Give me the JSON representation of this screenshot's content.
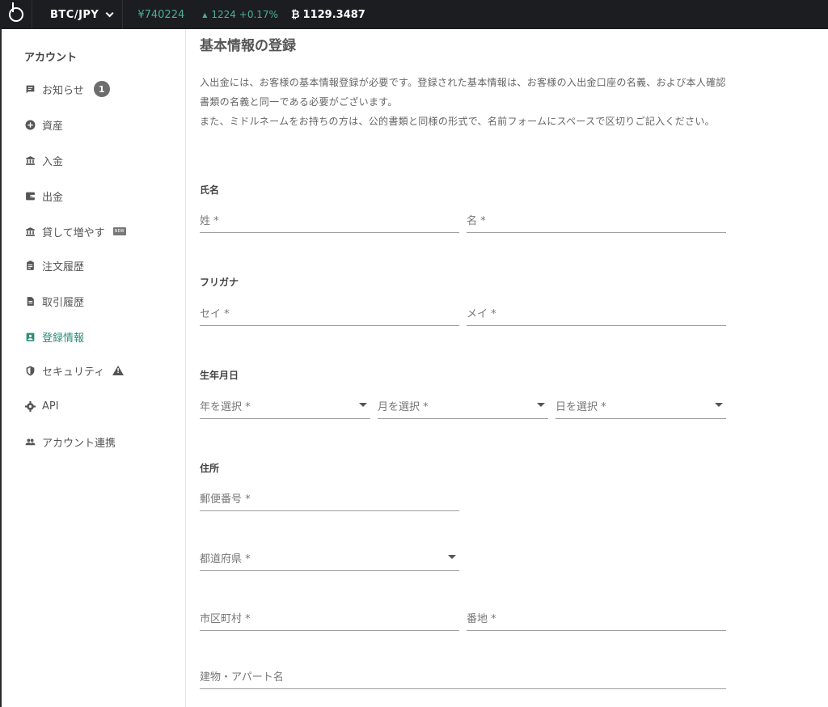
{
  "topbar": {
    "pair": "BTC/JPY",
    "price": "¥740224",
    "change": "1224 +0.17%",
    "btc_symbol": "₿",
    "btc_value": "1129.3487",
    "colors": {
      "bg": "#1b1d20",
      "up": "#4caf9a"
    }
  },
  "sidebar": {
    "title": "アカウント",
    "items": [
      {
        "label": "お知らせ",
        "icon": "message-icon",
        "badge": "1"
      },
      {
        "label": "資産",
        "icon": "plus-circle-icon"
      },
      {
        "label": "入金",
        "icon": "bank-icon"
      },
      {
        "label": "出金",
        "icon": "wallet-icon"
      },
      {
        "label": "貸して増やす",
        "icon": "bank-icon",
        "tag": "NEW"
      },
      {
        "label": "注文履歴",
        "icon": "clipboard-icon"
      },
      {
        "label": "取引履歴",
        "icon": "document-icon"
      },
      {
        "label": "登録情報",
        "icon": "id-badge-icon",
        "active": true
      },
      {
        "label": "セキュリティ",
        "icon": "shield-icon",
        "warning": true
      },
      {
        "label": "API",
        "icon": "gear-icon"
      },
      {
        "label": "アカウント連携",
        "icon": "people-icon"
      }
    ],
    "active_color": "#2d8c78"
  },
  "main": {
    "title": "基本情報の登録",
    "description": "入出金には、お客様の基本情報登録が必要です。登録された基本情報は、お客様の入出金口座の名義、および本人確認書類の名義と同一である必要がございます。\nまた、ミドルネームをお持ちの方は、公的書類と同様の形式で、名前フォームにスペースで区切りご記入ください。",
    "sections": {
      "name": {
        "label": "氏名",
        "last_name": "姓 *",
        "first_name": "名 *"
      },
      "kana": {
        "label": "フリガナ",
        "last_name": "セイ *",
        "first_name": "メイ *"
      },
      "birth": {
        "label": "生年月日",
        "year": "年を選択 *",
        "month": "月を選択 *",
        "day": "日を選択 *"
      },
      "address": {
        "label": "住所",
        "postal": "郵便番号 *",
        "prefecture": "都道府県 *",
        "city": "市区町村 *",
        "street": "番地 *",
        "building": "建物・アパート名"
      }
    }
  }
}
